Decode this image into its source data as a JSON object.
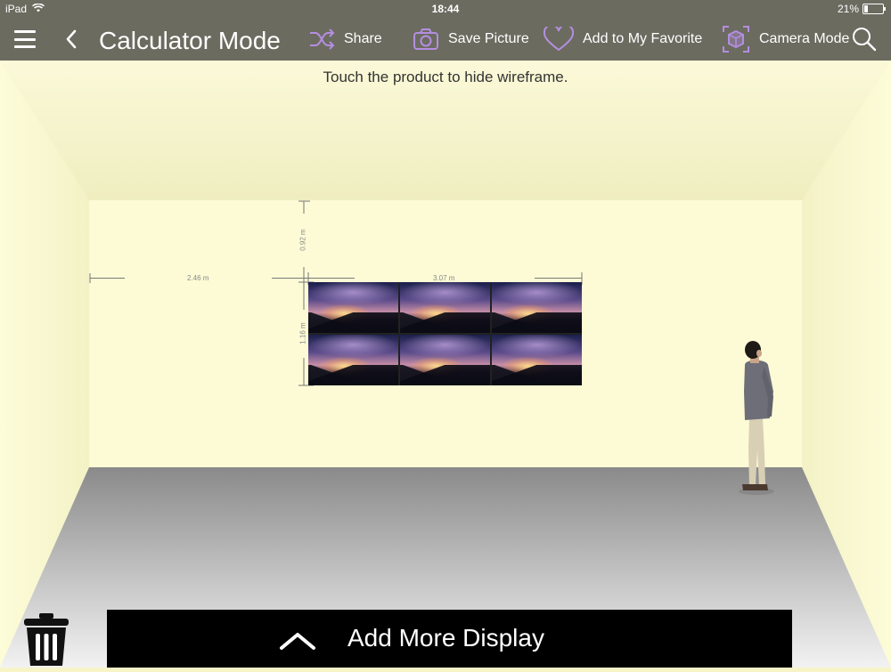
{
  "status_bar": {
    "device": "iPad",
    "time": "18:44",
    "battery": "21%",
    "battery_level": 0.21
  },
  "nav": {
    "title": "Calculator Mode",
    "share_label": "Share",
    "save_picture_label": "Save Picture",
    "favorite_label": "Add to My Favorite",
    "camera_mode_label": "Camera Mode",
    "icon_color": "#b48ee0"
  },
  "canvas": {
    "hint": "Touch the product to hide wireframe.",
    "dimensions": {
      "left_offset": "2.46 m",
      "top_offset": "0.92 m",
      "width": "3.07 m",
      "height": "1.16 m"
    },
    "display": {
      "columns": 3,
      "rows": 2
    }
  },
  "bottom": {
    "add_more_label": "Add More Display"
  },
  "colors": {
    "bar": "#6b6b60",
    "wall": "#fcfbd6",
    "floor": "#8c8c8c"
  }
}
